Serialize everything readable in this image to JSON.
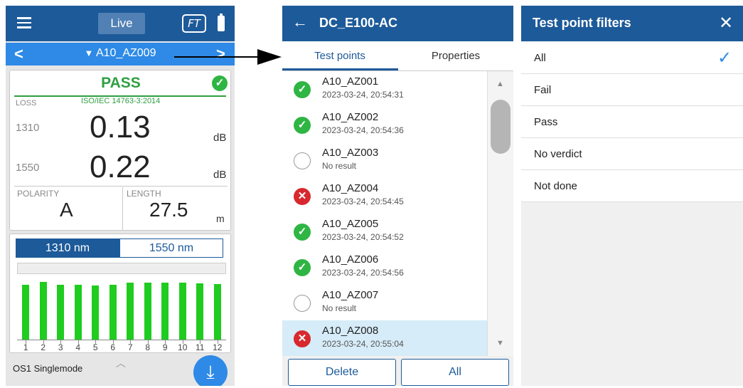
{
  "panel1": {
    "mode_label": "Live",
    "ft_label": "FT",
    "nav_title": "A10_AZ009",
    "verdict": "PASS",
    "loss_label": "LOSS",
    "standard": "ISO/IEC 14763-3:2014",
    "measurements": [
      {
        "wavelength": "1310",
        "value": "0.13",
        "unit": "dB"
      },
      {
        "wavelength": "1550",
        "value": "0.22",
        "unit": "dB"
      }
    ],
    "polarity_label": "POLARITY",
    "polarity_value": "A",
    "length_label": "LENGTH",
    "length_value": "27.5",
    "length_unit": "m",
    "wavelength_tabs": [
      "1310 nm",
      "1550 nm"
    ],
    "fiber_type": "OS1 Singlemode",
    "chart_data": {
      "type": "bar",
      "categories": [
        "1",
        "2",
        "3",
        "4",
        "5",
        "6",
        "7",
        "8",
        "9",
        "10",
        "11",
        "12"
      ],
      "values": [
        0.88,
        0.92,
        0.87,
        0.87,
        0.86,
        0.87,
        0.91,
        0.91,
        0.91,
        0.91,
        0.9,
        0.89
      ],
      "color": "#1fcc1f"
    }
  },
  "panel2": {
    "title": "DC_E100-AC",
    "tabs": [
      "Test points",
      "Properties"
    ],
    "items": [
      {
        "name": "A10_AZ001",
        "detail": "2023-03-24, 20:54:31",
        "status": "pass"
      },
      {
        "name": "A10_AZ002",
        "detail": "2023-03-24, 20:54:36",
        "status": "pass"
      },
      {
        "name": "A10_AZ003",
        "detail": "No result",
        "status": "none"
      },
      {
        "name": "A10_AZ004",
        "detail": "2023-03-24, 20:54:45",
        "status": "fail"
      },
      {
        "name": "A10_AZ005",
        "detail": "2023-03-24, 20:54:52",
        "status": "pass"
      },
      {
        "name": "A10_AZ006",
        "detail": "2023-03-24, 20:54:56",
        "status": "pass"
      },
      {
        "name": "A10_AZ007",
        "detail": "No result",
        "status": "none"
      },
      {
        "name": "A10_AZ008",
        "detail": "2023-03-24, 20:55:04",
        "status": "fail"
      }
    ],
    "selected_item": "A10_AZ008",
    "buttons": [
      "Delete",
      "All"
    ]
  },
  "panel3": {
    "title": "Test point filters",
    "options": [
      "All",
      "Fail",
      "Pass",
      "No verdict",
      "Not done"
    ],
    "selected_option": "All"
  },
  "colors": {
    "header": "#1d5a99",
    "accent": "#2e8ae6",
    "pass": "#2fb543",
    "fail": "#d8282f",
    "bars": "#1fcc1f"
  }
}
